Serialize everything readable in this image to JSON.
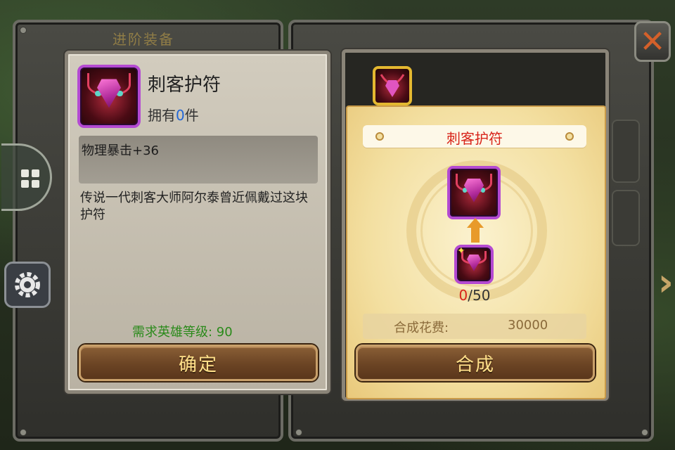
{
  "background": {
    "title": "进阶装备"
  },
  "item": {
    "name": "刺客护符",
    "own_prefix": "拥有",
    "own_count": "0",
    "own_suffix": "件",
    "stat": "物理暴击+36",
    "description": "传说一代刺客大师阿尔泰曾近佩戴过这块护符",
    "requirement": "需求英雄等级: 90",
    "icon": "assassin-amulet-icon"
  },
  "buttons": {
    "confirm": "确定",
    "craft": "合成",
    "close": "✕"
  },
  "craft": {
    "target_name": "刺客护符",
    "progress_current": "0",
    "progress_total": "/50",
    "cost_label": "合成花费:",
    "cost_value": "30000"
  },
  "colors": {
    "rarity_purple": "#b44ad2",
    "title_red": "#d8241a",
    "button_text": "#ffe08a",
    "requirement_green": "#2a8a1a"
  }
}
